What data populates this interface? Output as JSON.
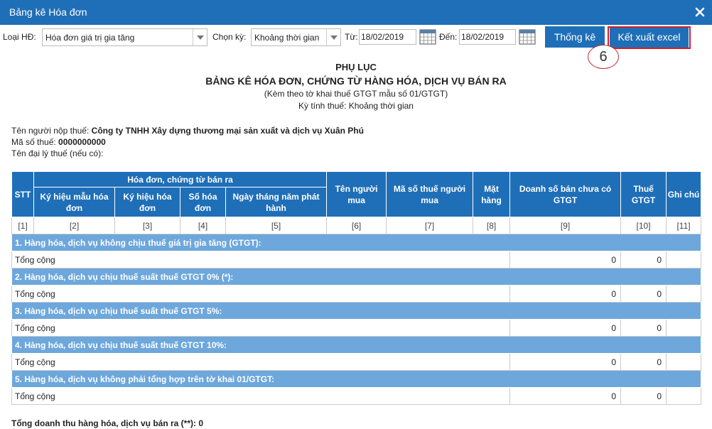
{
  "window": {
    "title": "Bảng kê Hóa đơn"
  },
  "toolbar": {
    "invoice_type_label": "Loại HĐ:",
    "invoice_type_value": "Hóa đơn giá trị gia tăng",
    "period_label": "Chọn kỳ:",
    "period_value": "Khoảng thời gian",
    "from_label": "Từ:",
    "from_date": "18/02/2019",
    "to_label": "Đến:",
    "to_date": "18/02/2019",
    "stats_button": "Thống kê",
    "export_button": "Kết xuất excel",
    "step_marker": "6"
  },
  "report": {
    "appendix": "PHỤ LỤC",
    "title": "BẢNG KÊ HÓA ĐƠN, CHỨNG TỪ HÀNG HÓA, DỊCH VỤ BÁN RA",
    "subtitle": "(Kèm theo tờ khai thuế GTGT mẫu số 01/GTGT)",
    "period_line": "Kỳ tính thuế: Khoảng thời gian",
    "taxpayer_label": "Tên người nộp thuế:",
    "taxpayer_name": "Công ty TNHH Xây dựng thương mại sản xuất và dịch vụ Xuân Phú",
    "tax_code_label": "Mã số thuế:",
    "tax_code": "0000000000",
    "agent_label": "Tên đại lý thuế (nếu có):"
  },
  "table": {
    "headers": {
      "stt": "STT",
      "group": "Hóa đơn, chứng từ bán ra",
      "form_symbol": "Ký hiệu mẫu hóa đơn",
      "invoice_symbol": "Ký hiệu hóa đơn",
      "invoice_no": "Số hóa đơn",
      "issue_date": "Ngày tháng năm phát hành",
      "buyer": "Tên người mua",
      "buyer_tax": "Mã số thuế người mua",
      "item": "Mặt hàng",
      "revenue": "Doanh số bán chưa có GTGT",
      "vat": "Thuế GTGT",
      "note": "Ghi chú"
    },
    "col_numbers": [
      "[1]",
      "[2]",
      "[3]",
      "[4]",
      "[5]",
      "[6]",
      "[7]",
      "[8]",
      "[9]",
      "[10]",
      "[11]"
    ],
    "sections": [
      {
        "title": "1. Hàng hóa, dịch vụ không chịu thuế giá trị gia tăng (GTGT):",
        "total_label": "Tổng cộng",
        "revenue": "0",
        "vat": "0"
      },
      {
        "title": "2. Hàng hóa, dịch vụ chịu thuế suất thuế GTGT 0% (*):",
        "total_label": "Tổng cộng",
        "revenue": "0",
        "vat": "0"
      },
      {
        "title": "3. Hàng hóa, dịch vụ chịu thuế suất thuế GTGT 5%:",
        "total_label": "Tổng cộng",
        "revenue": "0",
        "vat": "0"
      },
      {
        "title": "4. Hàng hóa, dịch vụ chịu thuế suất thuế GTGT 10%:",
        "total_label": "Tổng cộng",
        "revenue": "0",
        "vat": "0"
      },
      {
        "title": "5. Hàng hóa, dịch vụ không phải tổng hợp trên tờ khai 01/GTGT:",
        "total_label": "Tổng cộng",
        "revenue": "0",
        "vat": "0"
      }
    ]
  },
  "footer": {
    "grand_total_label": "Tổng doanh thu hàng hóa, dịch vụ bán ra (**):",
    "grand_total_value": "0"
  },
  "colors": {
    "primary": "#1f6fb8",
    "section_bg": "#6da7dc",
    "highlight": "#d2202b"
  }
}
